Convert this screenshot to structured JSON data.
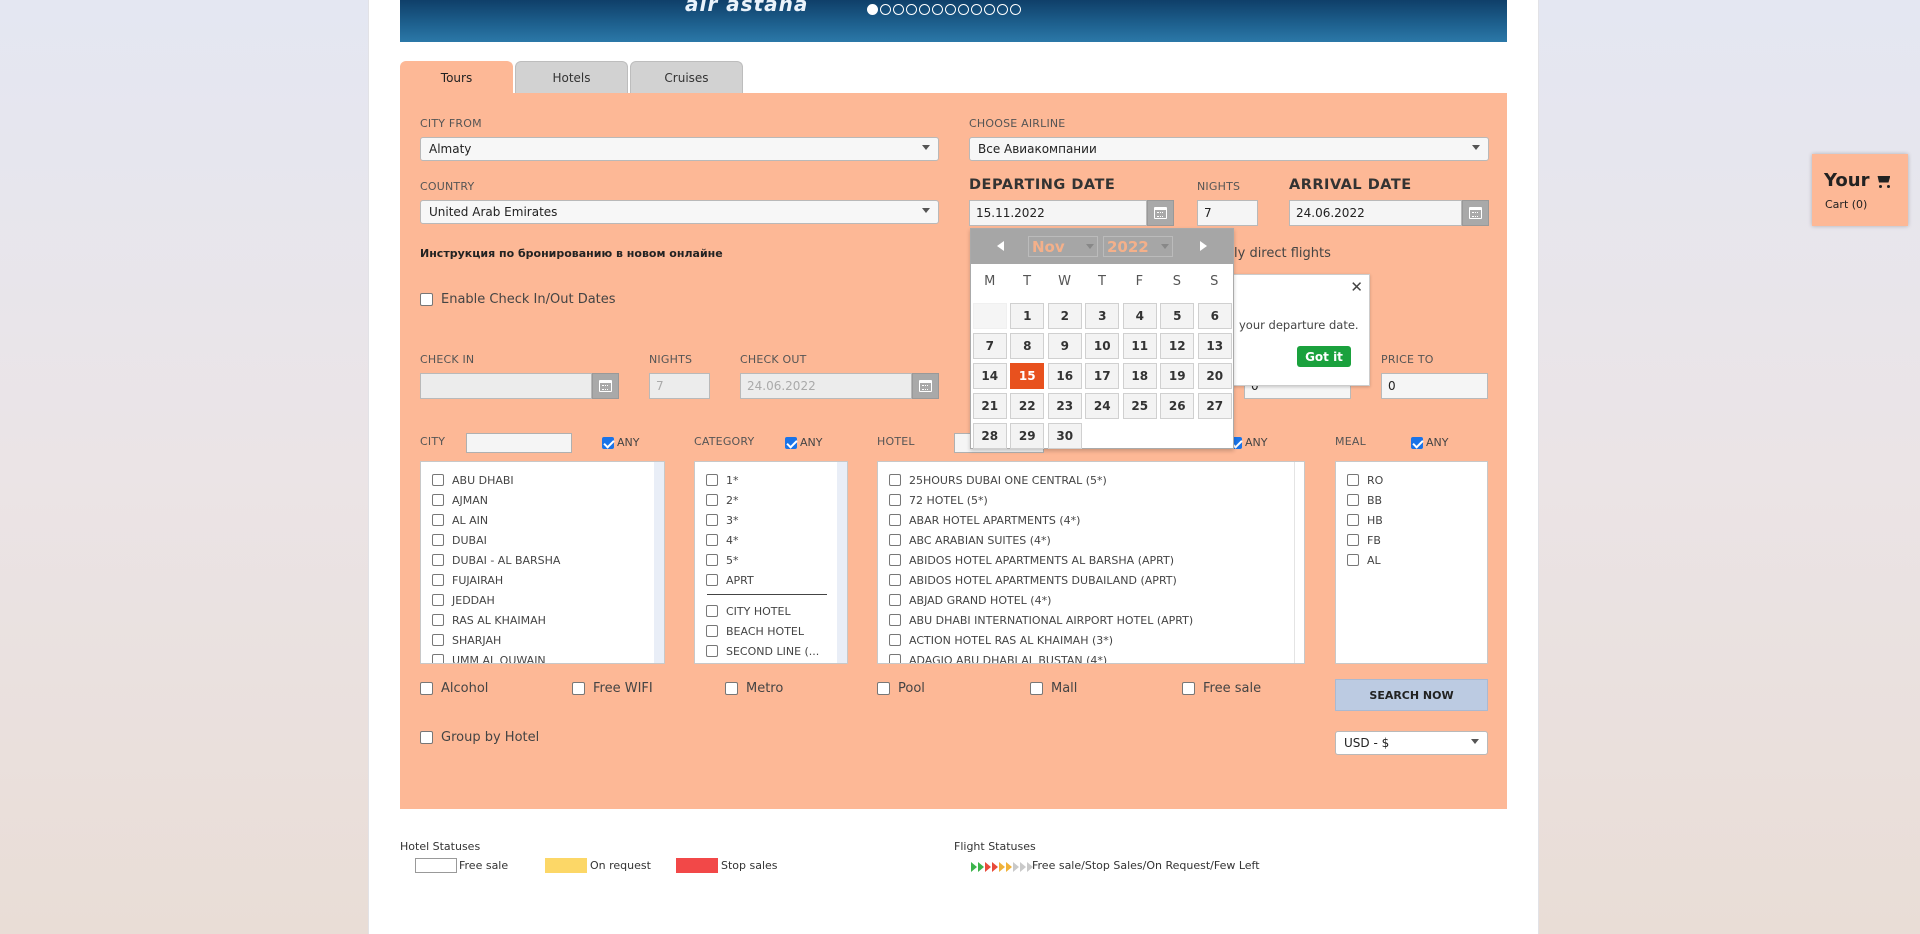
{
  "banner": {
    "logo_text": "air astana",
    "slide_count": 12,
    "active_slide": 1
  },
  "tabs": [
    {
      "label": "Tours",
      "active": true
    },
    {
      "label": "Hotels",
      "active": false
    },
    {
      "label": "Cruises",
      "active": false
    }
  ],
  "form": {
    "city_from": {
      "label": "CITY FROM",
      "value": "Almaty"
    },
    "airline": {
      "label": "CHOOSE AIRLINE",
      "value": "Все Авиакомпании"
    },
    "country": {
      "label": "COUNTRY",
      "value": "United Arab Emirates"
    },
    "departing": {
      "label": "DEPARTING DATE",
      "value": "15.11.2022"
    },
    "nights": {
      "label": "NIGHTS",
      "value": "7"
    },
    "arrival": {
      "label": "ARRIVAL DATE",
      "value": "24.06.2022"
    },
    "instructions_link": "Инструкция по бронированию в новом онлайне",
    "direct_flights_label": "ly direct flights",
    "enable_checkinout": "Enable Check In/Out Dates",
    "checkin": {
      "label": "CHECK IN",
      "value": ""
    },
    "nights2": {
      "label": "NIGHTS",
      "value": "7"
    },
    "checkout": {
      "label": "CHECK OUT",
      "value": "24.06.2022"
    },
    "price_from": {
      "value": "0"
    },
    "price_to": {
      "label": "PRICE TO",
      "value": "0"
    }
  },
  "filters": {
    "city": {
      "label": "CITY",
      "any": "ANY",
      "items": [
        "ABU DHABI",
        "AJMAN",
        "AL AIN",
        "DUBAI",
        "DUBAI - AL BARSHA",
        "FUJAIRAH",
        "JEDDAH",
        "RAS AL KHAIMAH",
        "SHARJAH",
        "UMM AL QUWAIN"
      ]
    },
    "category": {
      "label": "CATEGORY",
      "any": "ANY",
      "stars": [
        "1*",
        "2*",
        "3*",
        "4*",
        "5*",
        "APRT"
      ],
      "types": [
        "CITY HOTEL",
        "BEACH HOTEL",
        "SECOND LINE (..."
      ]
    },
    "hotel": {
      "label": "HOTEL",
      "any": "ANY",
      "items": [
        "25HOURS DUBAI ONE CENTRAL (5*)",
        "72 HOTEL (5*)",
        "ABAR HOTEL APARTMENTS (4*)",
        "ABC ARABIAN SUITES (4*)",
        "ABIDOS HOTEL APARTMENTS AL BARSHA (APRT)",
        "ABIDOS HOTEL APARTMENTS DUBAILAND (APRT)",
        "ABJAD GRAND HOTEL (4*)",
        "ABU DHABI INTERNATIONAL AIRPORT HOTEL (APRT)",
        "ACTION HOTEL RAS AL KHAIMAH (3*)",
        "ADAGIO ABU DHABI AL BUSTAN (4*)"
      ]
    },
    "meal": {
      "label": "MEAL",
      "any": "ANY",
      "items": [
        "RO",
        "BB",
        "HB",
        "FB",
        "AL"
      ]
    }
  },
  "amenities": [
    "Alcohol",
    "Free WIFI",
    "Metro",
    "Pool",
    "Mall",
    "Free sale"
  ],
  "group_by_hotel": "Group by Hotel",
  "search_button": "SEARCH NOW",
  "currency": "USD - $",
  "datepicker": {
    "month": "Nov",
    "year": "2022",
    "dows": [
      "M",
      "T",
      "W",
      "T",
      "F",
      "S",
      "S"
    ],
    "weeks": [
      [
        "",
        "1",
        "2",
        "3",
        "4",
        "5",
        "6"
      ],
      [
        "7",
        "8",
        "9",
        "10",
        "11",
        "12",
        "13"
      ],
      [
        "14",
        "15",
        "16",
        "17",
        "18",
        "19",
        "20"
      ],
      [
        "21",
        "22",
        "23",
        "24",
        "25",
        "26",
        "27"
      ],
      [
        "28",
        "29",
        "30"
      ]
    ],
    "selected": "15"
  },
  "tooltip": {
    "text": "your departure date.",
    "button": "Got it"
  },
  "cart": {
    "title": "Your",
    "count_text": "Cart (0)"
  },
  "legend": {
    "hotel_title": "Hotel Statuses",
    "hotel_items": [
      {
        "label": "Free sale",
        "color": "#ffffff"
      },
      {
        "label": "On request",
        "color": "#fcd767"
      },
      {
        "label": "Stop sales",
        "color": "#f24848"
      }
    ],
    "flight_title": "Flight Statuses",
    "flight_text": "Free sale/Stop Sales/On Request/Few Left",
    "flight_arrow_colors": [
      "#3cb44b",
      "#3cb44b",
      "#e84a3a",
      "#e84a3a",
      "#f0b23a",
      "#f0b23a",
      "#c9c9c9",
      "#c9c9c9",
      "#c9c9c9"
    ]
  },
  "colors": {
    "panel": "#fdb896",
    "today": "#e8511e",
    "got_it": "#1aa13d"
  }
}
